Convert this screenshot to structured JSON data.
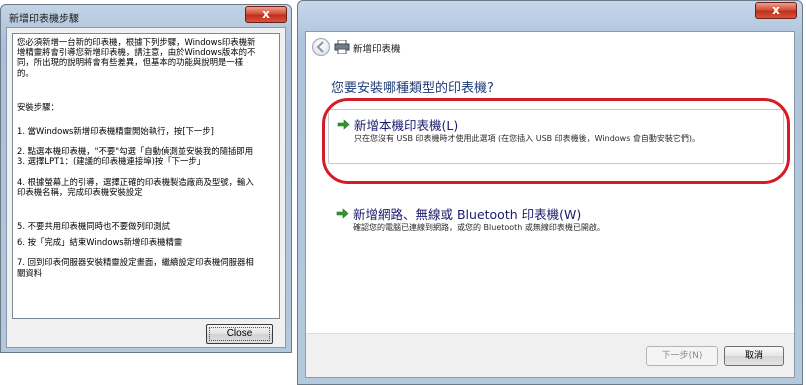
{
  "dialog_left": {
    "title": "新增印表機步驟",
    "close_glyph": "x",
    "lines": [
      "您必須新增一台新的印表機，根據下列步驟，Windows印表機新",
      "增精靈將會引導您新增印表機，請注意，由於Windows版本的不",
      "同，所出現的說明將會有些差異，但基本的功能與說明是一樣",
      "的。",
      "",
      "安裝步驟：",
      "1. 當Windows新增印表機精靈開始執行，按[下一步]",
      "2. 點選本機印表機，\"不要\"勾選「自動偵測並安裝我的隨插即用",
      "3. 選擇LPT1：(建議的印表機連接埠)按「下一步」",
      "4. 根據螢幕上的引導，選擇正確的印表機製造廠商及型號，輸入",
      "印表機名稱，完成印表機安裝設定",
      "5. 不要共用印表機同時也不要做列印測試",
      "6. 按「完成」結束Windows新增印表機精靈",
      "7. 回到印表伺服器安裝精靈設定畫面，繼續設定印表機伺服器相",
      "關資料"
    ],
    "close_button_label": "Close"
  },
  "wizard": {
    "close_glyph": "x",
    "window_title": "新增印表機",
    "question": "您要安裝哪種類型的印表機?",
    "options": [
      {
        "title": "新增本機印表機(L)",
        "desc": "只在您沒有 USB 印表機時才使用此選項 (在您插入 USB 印表機後，Windows 會自動安裝它們)。"
      },
      {
        "title": "新增網路、無線或 Bluetooth 印表機(W)",
        "desc": "確認您的電腦已連線到網路，或您的 Bluetooth 或無線印表機已開啟。"
      }
    ],
    "next_label": "下一步(N)",
    "cancel_label": "取消"
  },
  "colors": {
    "highlight": "#d81a26",
    "option_arrow": "#2e9a2e",
    "question_text": "#1e3c78"
  }
}
